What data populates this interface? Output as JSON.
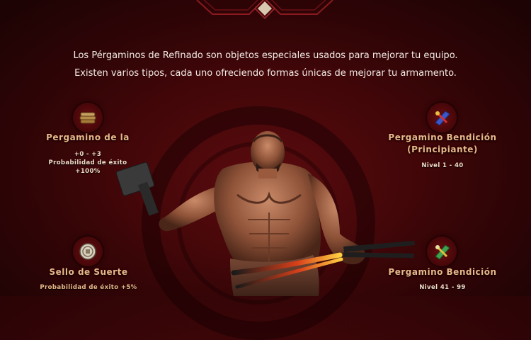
{
  "intro": {
    "line1": "Los Pérgaminos de Refinado son objetos especiales usados para mejorar tu equipo.",
    "line2": "Existen varios tipos, cada uno ofreciendo formas únicas de mejorar tu armamento."
  },
  "items": [
    {
      "icon": "scroll-stack-icon",
      "title": "Pergamino de la",
      "details": [
        "+0 - +3",
        "Probabilidad de éxito",
        "+100%"
      ]
    },
    {
      "icon": "blessing-scroll-icon",
      "title_line1": "Pergamino Bendición",
      "title_line2": "(Principiante)",
      "details": [
        "Nivel 1 - 40"
      ]
    },
    {
      "icon": "luck-seal-icon",
      "title": "Sello de Suerte",
      "details": [
        "Probabilidad de éxito +5%"
      ]
    },
    {
      "icon": "blessing-scroll-green-icon",
      "title": "Pergamino Bendición",
      "details": [
        "Nivel 41 - 99"
      ]
    }
  ],
  "colors": {
    "background": "#3f0608",
    "title_gold": "#e8b88a",
    "text": "#f4ece6"
  }
}
